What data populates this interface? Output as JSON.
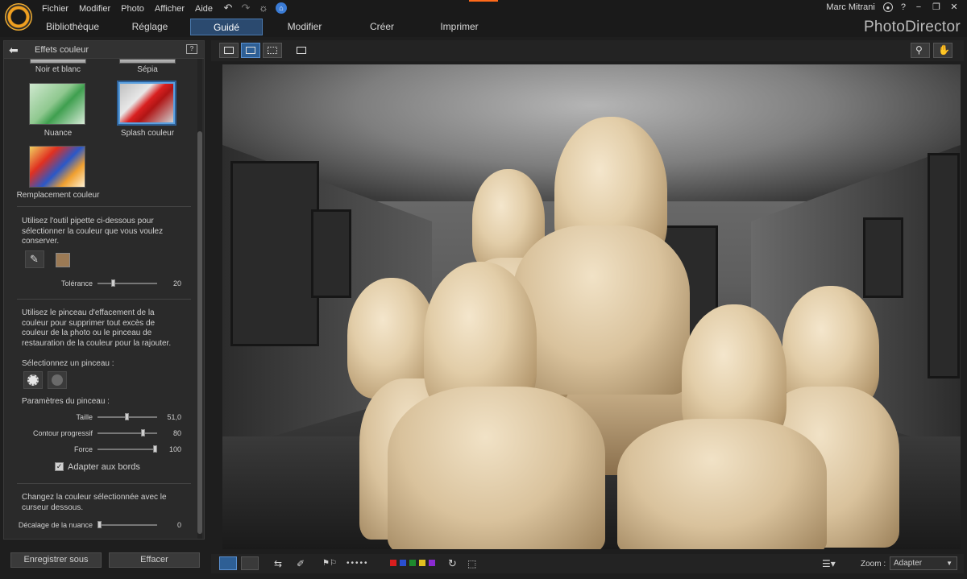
{
  "menu": {
    "items": [
      "Fichier",
      "Modifier",
      "Photo",
      "Afficher",
      "Aide"
    ]
  },
  "user": {
    "name": "Marc Mitrani",
    "help": "?"
  },
  "tabs": [
    "Bibliothèque",
    "Réglage",
    "Guidé",
    "Modifier",
    "Créer",
    "Imprimer"
  ],
  "active_tab": "Guidé",
  "brand": "PhotoDirector",
  "panel": {
    "title": "Effets couleur",
    "effects": [
      {
        "label": "Noir et blanc"
      },
      {
        "label": "Sépia"
      },
      {
        "label": "Nuance"
      },
      {
        "label": "Splash couleur",
        "selected": true
      },
      {
        "label": "Remplacement couleur"
      }
    ],
    "instruction_1": "Utilisez l'outil pipette ci-dessous pour sélectionner la couleur que vous voulez conserver.",
    "selected_color": "#9b7a55",
    "tolerance": {
      "label": "Tolérance",
      "value": "20",
      "fraction": 0.24
    },
    "instruction_2": "Utilisez le pinceau d'effacement de la couleur pour supprimer tout excès de couleur de la photo ou le pinceau de restauration de la couleur pour la rajouter.",
    "brush_select_label": "Sélectionnez un pinceau :",
    "brush_params_label": "Paramètres  du  pinceau :",
    "sliders": [
      {
        "label": "Taille",
        "value": "51,0",
        "fraction": 0.49
      },
      {
        "label": "Contour progressif",
        "value": "80",
        "fraction": 0.78
      },
      {
        "label": "Force",
        "value": "100",
        "fraction": 1.0
      }
    ],
    "adapt_edges": {
      "label": "Adapter aux bords",
      "checked": true
    },
    "instruction_3": "Changez la couleur sélectionnée avec le curseur dessous.",
    "hue_shift": {
      "label": "Décalage de la nuance",
      "value": "0",
      "fraction": 0.0
    },
    "save_as": "Enregistrer sous",
    "clear": "Effacer"
  },
  "bottom_toolbar": {
    "colors": [
      "#d81e1e",
      "#2a4fd0",
      "#1e8a2e",
      "#e0c020",
      "#8a2ad0"
    ],
    "zoom_label": "Zoom :",
    "zoom_value": "Adapter"
  }
}
